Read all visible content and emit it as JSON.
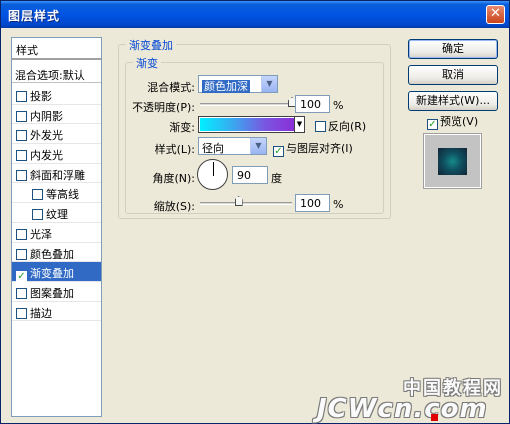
{
  "window": {
    "title": "图层样式",
    "close_glyph": "✕"
  },
  "styles_panel": {
    "header": "样式",
    "blend_options": "混合选项:默认",
    "items": [
      {
        "label": "投影",
        "checked": false,
        "sub": false,
        "selected": false
      },
      {
        "label": "内阴影",
        "checked": false,
        "sub": false,
        "selected": false
      },
      {
        "label": "外发光",
        "checked": false,
        "sub": false,
        "selected": false
      },
      {
        "label": "内发光",
        "checked": false,
        "sub": false,
        "selected": false
      },
      {
        "label": "斜面和浮雕",
        "checked": false,
        "sub": false,
        "selected": false
      },
      {
        "label": "等高线",
        "checked": false,
        "sub": true,
        "selected": false
      },
      {
        "label": "纹理",
        "checked": false,
        "sub": true,
        "selected": false
      },
      {
        "label": "光泽",
        "checked": false,
        "sub": false,
        "selected": false
      },
      {
        "label": "颜色叠加",
        "checked": false,
        "sub": false,
        "selected": false
      },
      {
        "label": "渐变叠加",
        "checked": true,
        "sub": false,
        "selected": true
      },
      {
        "label": "图案叠加",
        "checked": false,
        "sub": false,
        "selected": false
      },
      {
        "label": "描边",
        "checked": false,
        "sub": false,
        "selected": false
      }
    ]
  },
  "gradient_overlay": {
    "group_title": "渐变叠加",
    "sub_title": "渐变",
    "blend_mode_label": "混合模式:",
    "blend_mode_value": "颜色加深",
    "opacity_label": "不透明度(P):",
    "opacity_value": "100",
    "opacity_unit": "%",
    "opacity_fraction": 1.0,
    "gradient_label": "渐变:",
    "gradient_colors": [
      "#00f0ff",
      "#8a2fd6"
    ],
    "reverse_label": "反向(R)",
    "reverse_checked": false,
    "style_label": "样式(L):",
    "style_value": "径向",
    "align_label": "与图层对齐(I)",
    "align_checked": true,
    "angle_label": "角度(N):",
    "angle_value": "90",
    "angle_unit": "度",
    "scale_label": "缩放(S):",
    "scale_value": "100",
    "scale_unit": "%",
    "scale_fraction": 0.42
  },
  "buttons": {
    "ok": "确定",
    "cancel": "取消",
    "new_style": "新建样式(W)...",
    "preview_label": "预览(V)",
    "preview_checked": true
  },
  "watermark": {
    "cn": "中国教程网",
    "en": "JCWcn.com"
  },
  "colors": {
    "title_bar": "#0054e3",
    "selected": "#316ac5",
    "group_title": "#0046d5"
  }
}
